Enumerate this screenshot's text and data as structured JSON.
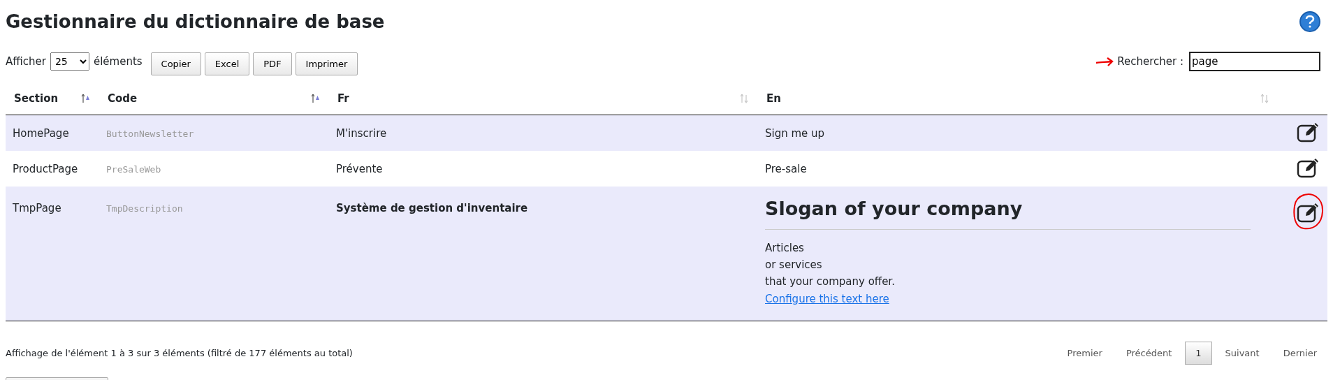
{
  "title": "Gestionnaire du dictionnaire de base",
  "length": {
    "label_before": "Afficher",
    "value": "25",
    "label_after": "éléments"
  },
  "buttons": [
    "Copier",
    "Excel",
    "PDF",
    "Imprimer"
  ],
  "search": {
    "label": "Rechercher :",
    "value": "page"
  },
  "columns": [
    {
      "label": "Section",
      "sorted": true
    },
    {
      "label": "Code",
      "sorted": true
    },
    {
      "label": "Fr",
      "sorted": false
    },
    {
      "label": "En",
      "sorted": false
    }
  ],
  "rows": [
    {
      "section": "HomePage",
      "code": "ButtonNewsletter",
      "fr": "M'inscrire",
      "fr_bold": false,
      "circled": false,
      "en": {
        "kind": "text",
        "text": "Sign me up"
      }
    },
    {
      "section": "ProductPage",
      "code": "PreSaleWeb",
      "fr": "Prévente",
      "fr_bold": false,
      "circled": false,
      "en": {
        "kind": "text",
        "text": "Pre-sale"
      }
    },
    {
      "section": "TmpPage",
      "code": "TmpDescription",
      "fr": "Système de gestion d'inventaire",
      "fr_bold": true,
      "circled": true,
      "en": {
        "kind": "rich",
        "heading": "Slogan of your company",
        "lines": [
          "Articles",
          "or services",
          "that your company offer."
        ],
        "link": "Configure this text here"
      }
    }
  ],
  "info": "Affichage de l'élément 1 à 3 sur 3 éléments (filtré de 177 éléments au total)",
  "pager": [
    {
      "label": "Premier",
      "selected": false
    },
    {
      "label": "Précédent",
      "selected": false
    },
    {
      "label": "1",
      "selected": true
    },
    {
      "label": "Suivant",
      "selected": false
    },
    {
      "label": "Dernier",
      "selected": false
    }
  ]
}
